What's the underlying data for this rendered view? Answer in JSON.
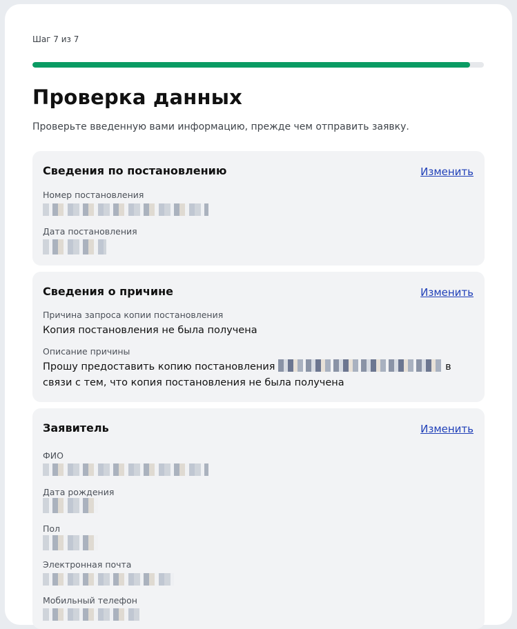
{
  "step": "Шаг 7 из 7",
  "progress": 0.97,
  "title": "Проверка данных",
  "subtitle": "Проверьте введенную вами информацию, прежде чем отправить заявку.",
  "colors": {
    "accent": "#0a9b63",
    "link": "#1f3fb8"
  },
  "sections": [
    {
      "title": "Сведения по постановлению",
      "edit": "Изменить",
      "fields": [
        {
          "label": "Номер постановления"
        },
        {
          "label": "Дата постановления"
        }
      ]
    },
    {
      "title": "Сведения о причине",
      "edit": "Изменить",
      "fields": [
        {
          "label": "Причина запроса копии постановления",
          "value": "Копия постановления не была получена"
        },
        {
          "label": "Описание причины",
          "value_before": "Прошу предоставить копию постановления",
          "value_after": "в связи с тем, что копия постановления не была получена"
        }
      ]
    },
    {
      "title": "Заявитель",
      "edit": "Изменить",
      "fields": [
        {
          "label": "ФИО"
        },
        {
          "label": "Дата рождения"
        },
        {
          "label": "Пол"
        },
        {
          "label": "Электронная почта"
        },
        {
          "label": "Мобильный телефон"
        }
      ]
    }
  ]
}
